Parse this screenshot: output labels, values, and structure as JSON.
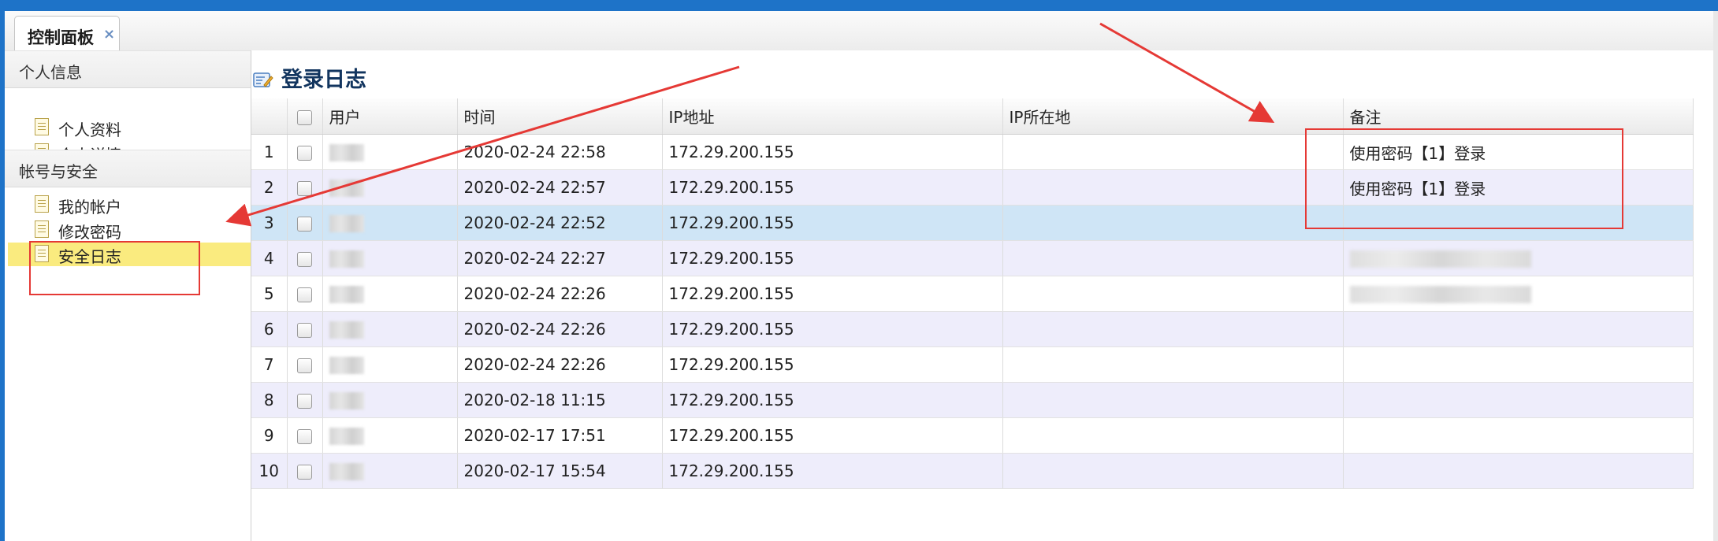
{
  "tab": {
    "title": "控制面板",
    "close_glyph": "×"
  },
  "sidebar": {
    "sections": [
      {
        "title": "个人信息",
        "items": [
          "个人资料",
          "个人详情"
        ]
      },
      {
        "title": "帐号与安全",
        "items": [
          "我的帐户",
          "修改密码",
          "安全日志"
        ]
      }
    ],
    "active_item": "安全日志"
  },
  "panel": {
    "title": "登录日志",
    "columns": [
      "用户",
      "时间",
      "IP地址",
      "IP所在地",
      "备注"
    ],
    "rows": [
      {
        "n": "1",
        "time": "2020-02-24 22:58",
        "ip": "172.29.200.155",
        "loc": "",
        "note": "使用密码【1】登录"
      },
      {
        "n": "2",
        "time": "2020-02-24 22:57",
        "ip": "172.29.200.155",
        "loc": "",
        "note": "使用密码【1】登录"
      },
      {
        "n": "3",
        "time": "2020-02-24 22:52",
        "ip": "172.29.200.155",
        "loc": "",
        "note": ""
      },
      {
        "n": "4",
        "time": "2020-02-24 22:27",
        "ip": "172.29.200.155",
        "loc": "",
        "note": ""
      },
      {
        "n": "5",
        "time": "2020-02-24 22:26",
        "ip": "172.29.200.155",
        "loc": "",
        "note": ""
      },
      {
        "n": "6",
        "time": "2020-02-24 22:26",
        "ip": "172.29.200.155",
        "loc": "",
        "note": ""
      },
      {
        "n": "7",
        "time": "2020-02-24 22:26",
        "ip": "172.29.200.155",
        "loc": "",
        "note": ""
      },
      {
        "n": "8",
        "time": "2020-02-18 11:15",
        "ip": "172.29.200.155",
        "loc": "",
        "note": ""
      },
      {
        "n": "9",
        "time": "2020-02-17 17:51",
        "ip": "172.29.200.155",
        "loc": "",
        "note": ""
      },
      {
        "n": "10",
        "time": "2020-02-17 15:54",
        "ip": "172.29.200.155",
        "loc": "",
        "note": ""
      }
    ],
    "selected_row": "3"
  },
  "colors": {
    "top_bar": "#1e73c8",
    "active_item_bg": "#faeb7f",
    "row_alt_bg": "#eeedfb",
    "row_selected_bg": "#cfe5f6",
    "annotation": "#e53935"
  },
  "icons": {
    "sidebar_item": "document-icon",
    "panel_title": "log-edit-icon",
    "tab_close": "close-icon"
  }
}
